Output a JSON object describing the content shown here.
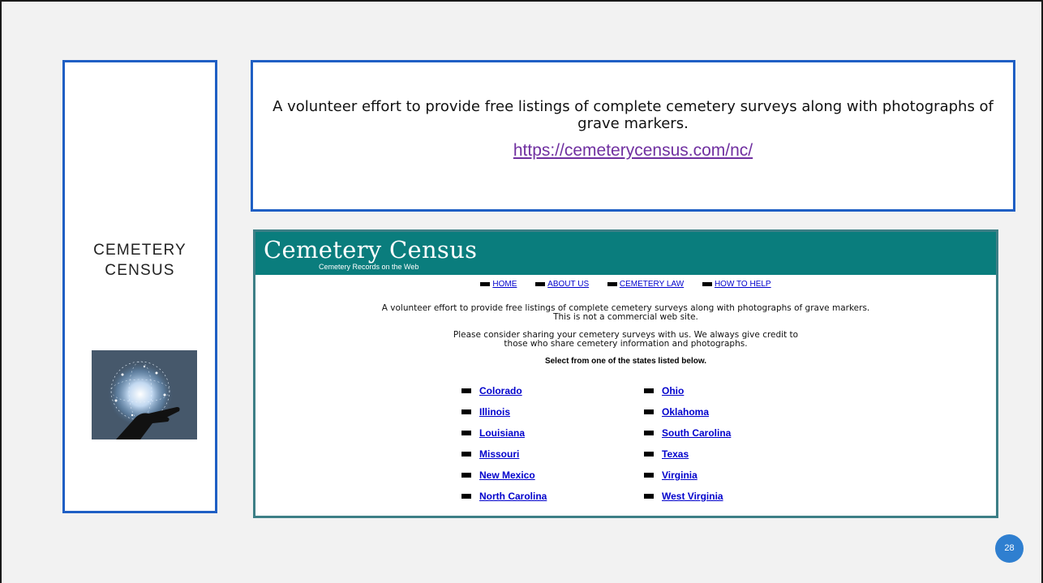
{
  "slide": {
    "left_title_line1": "CEMETERY",
    "left_title_line2": "CENSUS",
    "description": "A volunteer effort to provide free listings of complete cemetery surveys along with photographs of grave markers.",
    "link": "https://cemeterycensus.com/nc/",
    "page_number": "28"
  },
  "website": {
    "title": "Cemetery Census",
    "subtitle": "Cemetery Records on the Web",
    "nav": [
      "HOME",
      "ABOUT US",
      "CEMETERY LAW",
      "HOW TO HELP"
    ],
    "intro_line1": "A volunteer effort to provide free listings of complete cemetery surveys along with photographs of grave markers.",
    "intro_line2": "This is not a commercial web site.",
    "share_line1": "Please consider sharing your cemetery surveys with us. We always give credit to",
    "share_line2": "those who share cemetery information and photographs.",
    "select_prompt": "Select from one of the states listed below.",
    "states_col1": [
      "Colorado",
      "Illinois",
      "Louisiana",
      "Missouri",
      "New Mexico",
      "North Carolina"
    ],
    "states_col2": [
      "Ohio",
      "Oklahoma",
      "South Carolina",
      "Texas",
      "Virginia",
      "West Virginia"
    ]
  },
  "colors": {
    "accent_border": "#1f5fc4",
    "site_header": "#0a7d7d",
    "link_visited": "#7030a0",
    "page_badge": "#2f7fd0"
  },
  "icons": {
    "thumbnail": "globe-hand-image",
    "nav_bullet": "square-bullet-icon"
  }
}
